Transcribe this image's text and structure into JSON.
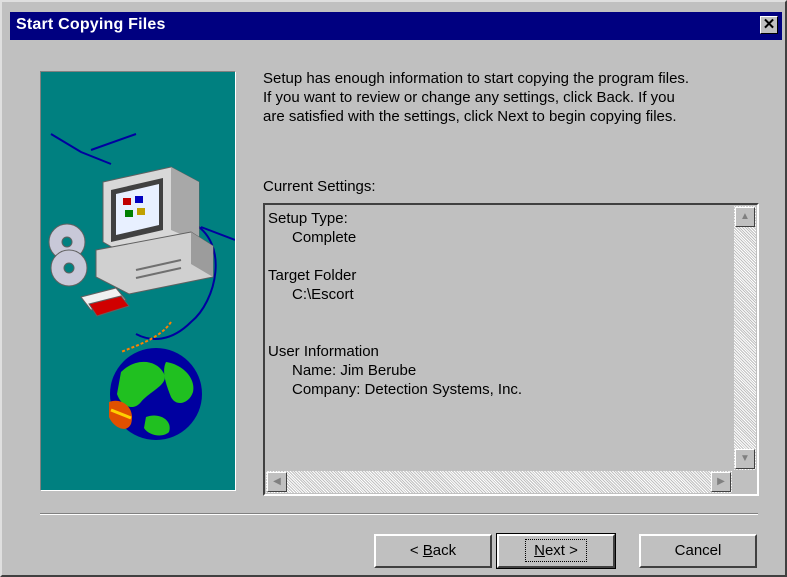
{
  "window": {
    "title": "Start Copying Files",
    "close_glyph": "✕"
  },
  "intro_lines": [
    "Setup has enough information to start copying the program files.",
    "If you want to review or change any settings, click Back.  If you",
    "are satisfied with the settings, click Next to begin copying files."
  ],
  "settings": {
    "label": "Current Settings:",
    "setup_type_heading": "Setup Type:",
    "setup_type_value": "Complete",
    "target_folder_heading": "Target Folder",
    "target_folder_value": "C:\\Escort",
    "user_info_heading": "User Information",
    "user_name": "Name:  Jim Berube",
    "company": "Company:  Detection Systems, Inc."
  },
  "buttons": {
    "back_prefix": "< ",
    "back_key": "B",
    "back_rest": "ack",
    "next_key": "N",
    "next_rest": "ext >",
    "cancel": "Cancel"
  },
  "icons": {
    "close": "close-icon",
    "scroll_up": "scroll-up-icon",
    "scroll_down": "scroll-down-icon",
    "scroll_left": "scroll-left-icon",
    "scroll_right": "scroll-right-icon",
    "illustration": "computer-cd-globe-illustration"
  },
  "colors": {
    "titlebar": "#000080",
    "face": "#c0c0c0",
    "art_background": "#008080"
  }
}
